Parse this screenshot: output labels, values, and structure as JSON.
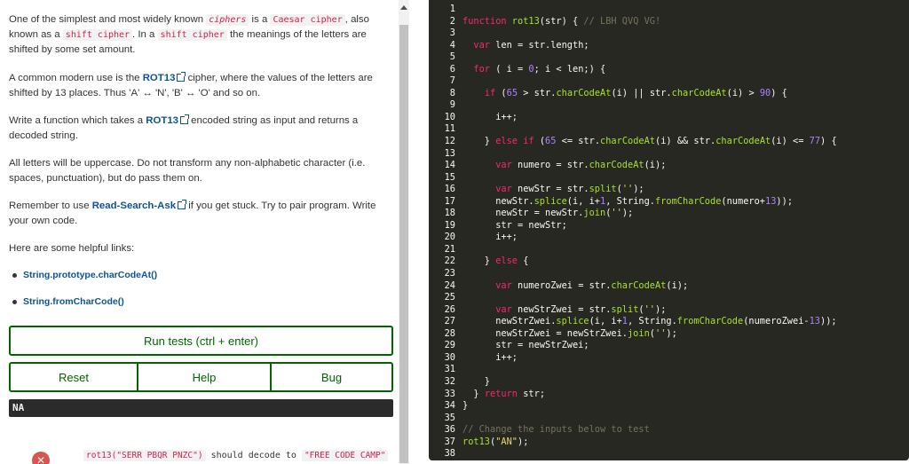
{
  "instructions": {
    "p1": {
      "a": "One of the simplest and most widely known ",
      "b": "ciphers",
      "c": " is a ",
      "d": "Caesar cipher",
      "e": ", also known as a ",
      "f": "shift cipher",
      "g": ". In a ",
      "h": "shift cipher",
      "i": " the meanings of the letters are shifted by some set amount."
    },
    "p2": {
      "a": "A common modern use is the ",
      "link": "ROT13",
      "b": " cipher, where the values of the letters are shifted by 13 places. Thus 'A' ↔ 'N', 'B' ↔ 'O' and so on."
    },
    "p3": {
      "a": "Write a function which takes a ",
      "link": "ROT13",
      "b": " encoded string as input and returns a decoded string."
    },
    "p4": "All letters will be uppercase. Do not transform any non-alphabetic character (i.e. spaces, punctuation), but do pass them on.",
    "p5": {
      "a": "Remember to use ",
      "link": "Read-Search-Ask",
      "b": " if you get stuck. Try to pair program. Write your own code."
    },
    "p6": "Here are some helpful links:",
    "links": [
      "String.prototype.charCodeAt()",
      "String.fromCharCode()"
    ]
  },
  "buttons": {
    "run": "Run tests (ctrl + enter)",
    "reset": "Reset",
    "help": "Help",
    "bug": "Bug"
  },
  "output": "NA",
  "test": {
    "icon": "✕",
    "call": "rot13(\"SERR PBQR PNZC\")",
    "text": " should decode to ",
    "expected": "\"FREE CODE CAMP\""
  },
  "editor": {
    "theme_bg": "#272822",
    "line_numbers": [
      "1",
      "2",
      "3",
      "4",
      "5",
      "6",
      "7",
      "8",
      "9",
      "10",
      "11",
      "12",
      "13",
      "14",
      "15",
      "16",
      "17",
      "18",
      "19",
      "20",
      "21",
      "22",
      "23",
      "24",
      "25",
      "26",
      "27",
      "28",
      "29",
      "30",
      "31",
      "32",
      "33",
      "34",
      "35",
      "36",
      "37",
      "38"
    ],
    "lines": [
      [],
      [
        [
          "kw",
          "function "
        ],
        [
          "fn",
          "rot13"
        ],
        [
          "nm",
          "(str) { "
        ],
        [
          "cm",
          "// LBH QVQ VG!"
        ]
      ],
      [],
      [
        [
          "nm",
          "  "
        ],
        [
          "kw",
          "var "
        ],
        [
          "nm",
          "len = str.length;"
        ]
      ],
      [],
      [
        [
          "nm",
          "  "
        ],
        [
          "kw",
          "for "
        ],
        [
          "nm",
          "( i = "
        ],
        [
          "num",
          "0"
        ],
        [
          "nm",
          "; i < len;) {"
        ]
      ],
      [],
      [
        [
          "nm",
          "    "
        ],
        [
          "kw",
          "if "
        ],
        [
          "nm",
          "("
        ],
        [
          "num",
          "65"
        ],
        [
          "nm",
          " > str."
        ],
        [
          "fn",
          "charCodeAt"
        ],
        [
          "nm",
          "(i) || str."
        ],
        [
          "fn",
          "charCodeAt"
        ],
        [
          "nm",
          "(i) > "
        ],
        [
          "num",
          "90"
        ],
        [
          "nm",
          ") {"
        ]
      ],
      [],
      [
        [
          "nm",
          "      i++;"
        ]
      ],
      [],
      [
        [
          "nm",
          "    } "
        ],
        [
          "kw",
          "else if "
        ],
        [
          "nm",
          "("
        ],
        [
          "num",
          "65"
        ],
        [
          "nm",
          " <= str."
        ],
        [
          "fn",
          "charCodeAt"
        ],
        [
          "nm",
          "(i) && str."
        ],
        [
          "fn",
          "charCodeAt"
        ],
        [
          "nm",
          "(i) <= "
        ],
        [
          "num",
          "77"
        ],
        [
          "nm",
          ") {"
        ]
      ],
      [],
      [
        [
          "nm",
          "      "
        ],
        [
          "kw",
          "var "
        ],
        [
          "nm",
          "numero = str."
        ],
        [
          "fn",
          "charCodeAt"
        ],
        [
          "nm",
          "(i);"
        ]
      ],
      [],
      [
        [
          "nm",
          "      "
        ],
        [
          "kw",
          "var "
        ],
        [
          "nm",
          "newStr = str."
        ],
        [
          "fn",
          "split"
        ],
        [
          "nm",
          "("
        ],
        [
          "str",
          "''"
        ],
        [
          "nm",
          ");"
        ]
      ],
      [
        [
          "nm",
          "      newStr."
        ],
        [
          "fn",
          "splice"
        ],
        [
          "nm",
          "(i, i+"
        ],
        [
          "num",
          "1"
        ],
        [
          "nm",
          ", String."
        ],
        [
          "fn",
          "fromCharCode"
        ],
        [
          "nm",
          "(numero+"
        ],
        [
          "num",
          "13"
        ],
        [
          "nm",
          "));"
        ]
      ],
      [
        [
          "nm",
          "      newStr = newStr."
        ],
        [
          "fn",
          "join"
        ],
        [
          "nm",
          "("
        ],
        [
          "str",
          "''"
        ],
        [
          "nm",
          ");"
        ]
      ],
      [
        [
          "nm",
          "      str = newStr;"
        ]
      ],
      [
        [
          "nm",
          "      i++;"
        ]
      ],
      [],
      [
        [
          "nm",
          "    } "
        ],
        [
          "kw",
          "else "
        ],
        [
          "nm",
          "{"
        ]
      ],
      [],
      [
        [
          "nm",
          "      "
        ],
        [
          "kw",
          "var "
        ],
        [
          "nm",
          "numeroZwei = str."
        ],
        [
          "fn",
          "charCodeAt"
        ],
        [
          "nm",
          "(i);"
        ]
      ],
      [],
      [
        [
          "nm",
          "      "
        ],
        [
          "kw",
          "var "
        ],
        [
          "nm",
          "newStrZwei = str."
        ],
        [
          "fn",
          "split"
        ],
        [
          "nm",
          "("
        ],
        [
          "str",
          "''"
        ],
        [
          "nm",
          ");"
        ]
      ],
      [
        [
          "nm",
          "      newStrZwei."
        ],
        [
          "fn",
          "splice"
        ],
        [
          "nm",
          "(i, i+"
        ],
        [
          "num",
          "1"
        ],
        [
          "nm",
          ", String."
        ],
        [
          "fn",
          "fromCharCode"
        ],
        [
          "nm",
          "(numeroZwei-"
        ],
        [
          "num",
          "13"
        ],
        [
          "nm",
          "));"
        ]
      ],
      [
        [
          "nm",
          "      newStrZwei = newStrZwei."
        ],
        [
          "fn",
          "join"
        ],
        [
          "nm",
          "("
        ],
        [
          "str",
          "''"
        ],
        [
          "nm",
          ");"
        ]
      ],
      [
        [
          "nm",
          "      str = newStrZwei;"
        ]
      ],
      [
        [
          "nm",
          "      i++;"
        ]
      ],
      [],
      [
        [
          "nm",
          "    }"
        ]
      ],
      [
        [
          "nm",
          "  } "
        ],
        [
          "kw",
          "return "
        ],
        [
          "nm",
          "str;"
        ]
      ],
      [
        [
          "nm",
          "}"
        ]
      ],
      [],
      [
        [
          "cm",
          "// Change the inputs below to test"
        ]
      ],
      [
        [
          "fn",
          "rot13"
        ],
        [
          "nm",
          "("
        ],
        [
          "str",
          "\"AN\""
        ],
        [
          "nm",
          ");"
        ]
      ],
      []
    ]
  }
}
